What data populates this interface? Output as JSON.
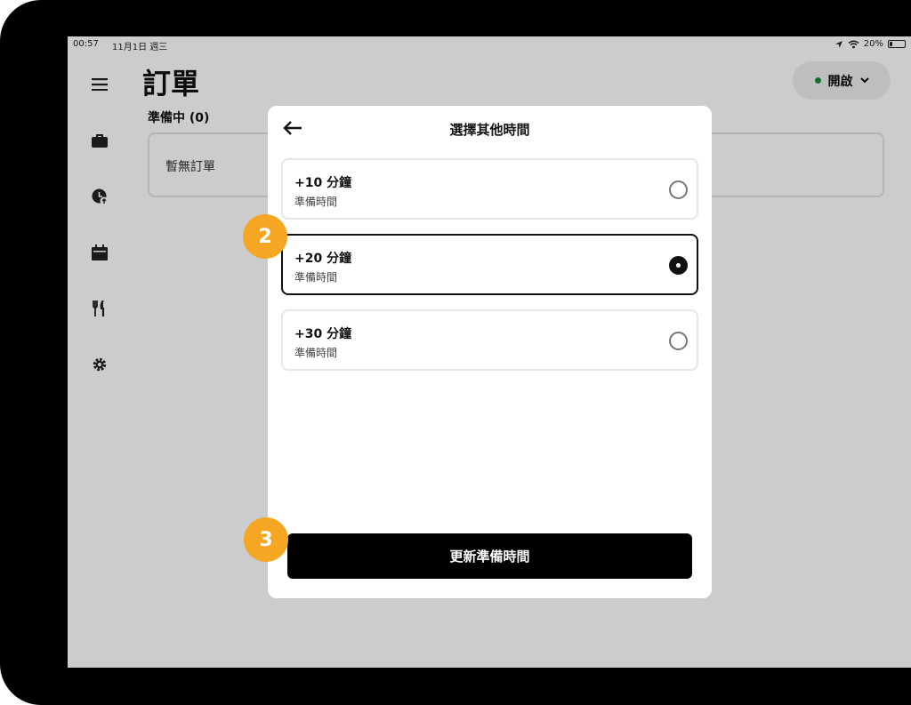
{
  "status_bar": {
    "time": "00:57",
    "date": "11月1日 週三",
    "battery": "20%",
    "battery_level": 0.2
  },
  "header": {
    "title": "訂單"
  },
  "section": {
    "label": "準備中 (0)",
    "empty_text": "暫無訂單"
  },
  "store_status": {
    "label": "開啟",
    "dot_color": "#1a8a3a"
  },
  "sidebar": {
    "items": [
      {
        "icon": "menu-icon"
      },
      {
        "icon": "orders-bag-icon"
      },
      {
        "icon": "history-clock-icon"
      },
      {
        "icon": "calendar-icon"
      },
      {
        "icon": "menu-fork-knife-icon"
      },
      {
        "icon": "settings-gear-icon"
      }
    ]
  },
  "modal": {
    "title": "選擇其他時間",
    "options": [
      {
        "title": "+10 分鐘",
        "subtitle": "準備時間",
        "selected": false
      },
      {
        "title": "+20 分鐘",
        "subtitle": "準備時間",
        "selected": true
      },
      {
        "title": "+30 分鐘",
        "subtitle": "準備時間",
        "selected": false
      }
    ],
    "button_label": "更新準備時間"
  },
  "annotations": {
    "step2": "2",
    "step3": "3",
    "badge_color": "#f5a623"
  }
}
